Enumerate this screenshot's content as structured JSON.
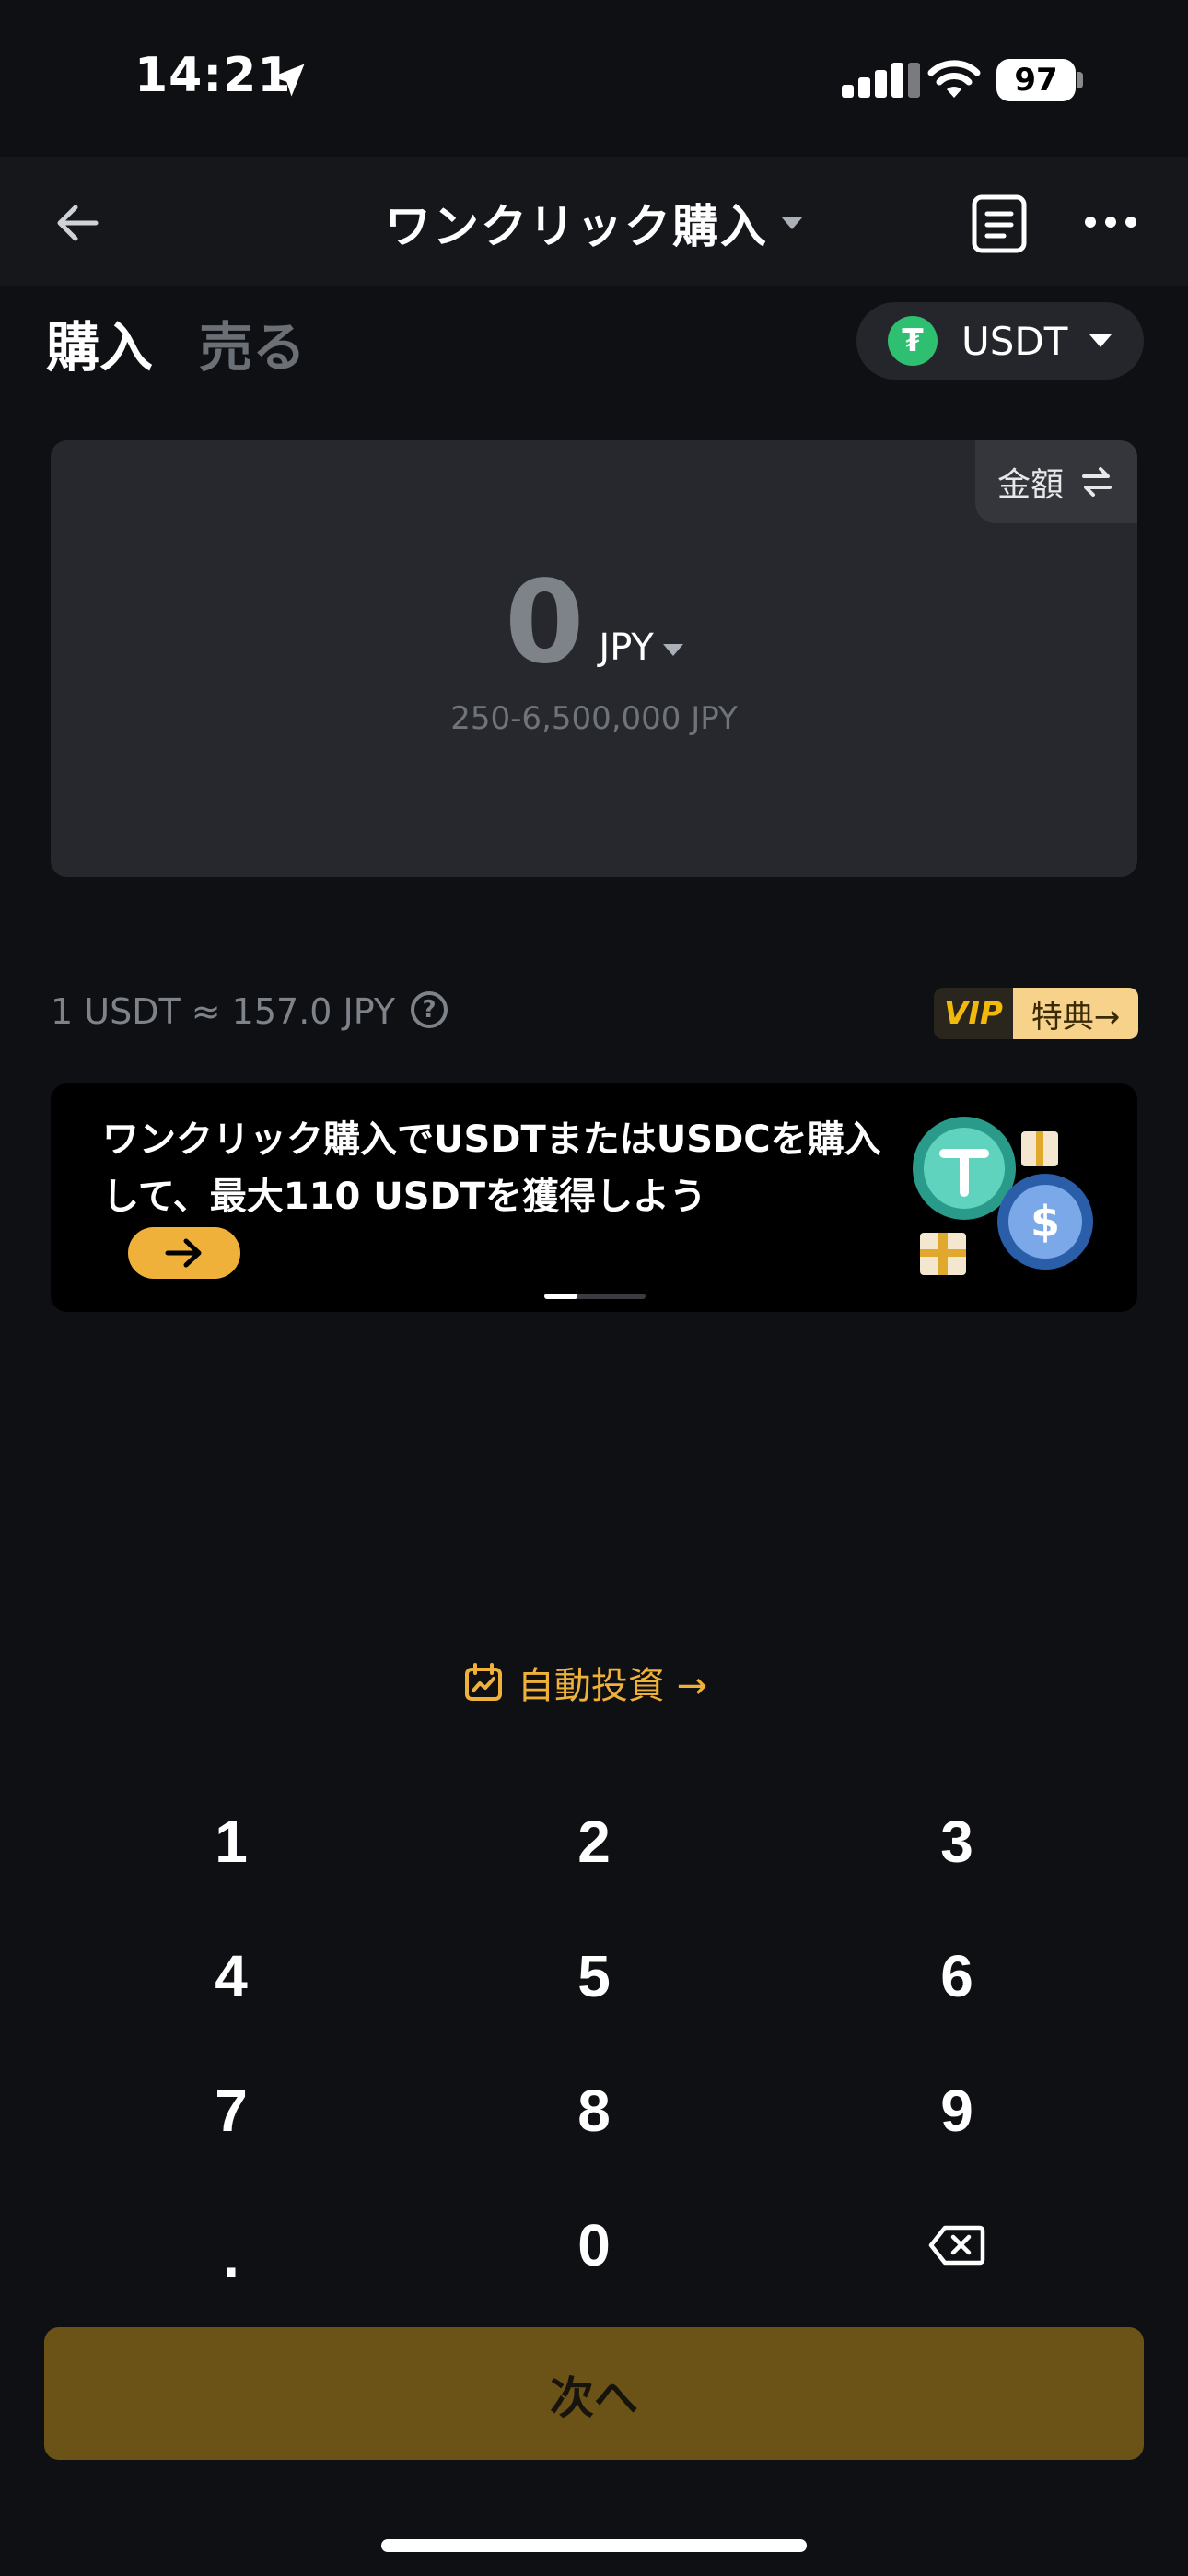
{
  "status_bar": {
    "time": "14:21",
    "battery": "97",
    "icons": [
      "location-arrow-icon",
      "cellular-signal-icon",
      "wifi-icon",
      "battery-icon"
    ]
  },
  "header": {
    "title": "ワンクリック購入",
    "icons": [
      "back-arrow-icon",
      "order-history-icon",
      "more-icon"
    ]
  },
  "tabs": {
    "buy": "購入",
    "sell": "売る",
    "active": "buy"
  },
  "coin_selector": {
    "symbol": "USDT",
    "logo_glyph": "₮",
    "logo_color": "#2fbf71"
  },
  "amount_card": {
    "mode_label": "金額",
    "value": "0",
    "currency": "JPY",
    "range": "250-6,500,000 JPY"
  },
  "rate": {
    "text": "1 USDT ≈ 157.0 JPY",
    "help_glyph": "?"
  },
  "vip_badge": {
    "vip": "VIP",
    "perk": "特典→"
  },
  "promo_banner": {
    "text": "ワンクリック購入でUSDTまたはUSDCを購入して、最大110 USDTを獲得しよう",
    "slide_count": 3,
    "active_slide": 1
  },
  "auto_invest": {
    "label": "自動投資 →"
  },
  "keypad": {
    "keys": [
      "1",
      "2",
      "3",
      "4",
      "5",
      "6",
      "7",
      "8",
      "9",
      ".",
      "0",
      "backspace"
    ]
  },
  "next_button": {
    "label": "次へ",
    "enabled": false
  },
  "colors": {
    "background": "#0f1013",
    "accent": "#f0b13a",
    "card": "#26282d",
    "next_disabled": "#6b5317"
  }
}
